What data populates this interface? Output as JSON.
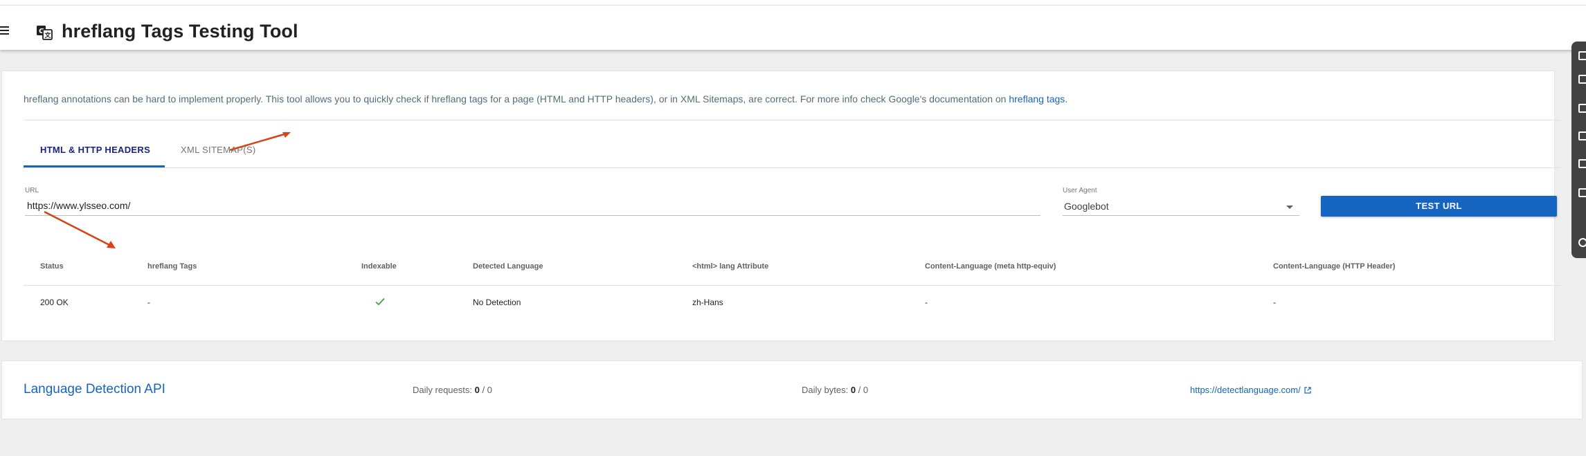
{
  "appbar": {
    "title": "hreflang Tags Testing Tool"
  },
  "intro": {
    "text": "hreflang annotations can be hard to implement properly. This tool allows you to quickly check if hreflang tags for a page (HTML and HTTP headers), or in XML Sitemaps, are correct. For more info check Google's documentation on ",
    "link_text": "hreflang tags",
    "suffix": "."
  },
  "tabs": [
    {
      "label": "HTML & HTTP HEADERS",
      "active": true
    },
    {
      "label": "XML SITEMAP(S)",
      "active": false
    }
  ],
  "form": {
    "url_label": "URL",
    "url_value": "https://www.ylsseo.com/",
    "user_agent_label": "User Agent",
    "user_agent_value": "Googlebot",
    "test_button": "TEST URL"
  },
  "results": {
    "headers": [
      "Status",
      "hreflang Tags",
      "Indexable",
      "Detected Language",
      "<html> lang Attribute",
      "Content-Language (meta http-equiv)",
      "Content-Language (HTTP Header)"
    ],
    "row": {
      "status": "200 OK",
      "hreflang_tags": "-",
      "indexable_icon": "check-icon",
      "detected_language": "No Detection",
      "html_lang": "zh-Hans",
      "content_language_meta": "-",
      "content_language_header": "-"
    }
  },
  "api": {
    "title": "Language Detection API",
    "daily_requests_label": "Daily requests: ",
    "daily_requests_used": "0",
    "daily_requests_total": " / 0",
    "daily_bytes_label": "Daily bytes: ",
    "daily_bytes_used": "0",
    "daily_bytes_total": " / 0",
    "link": "https://detectlanguage.com/"
  },
  "colors": {
    "accent": "#1565c0",
    "annotation_arrow": "#d84315",
    "check": "#43a047"
  }
}
